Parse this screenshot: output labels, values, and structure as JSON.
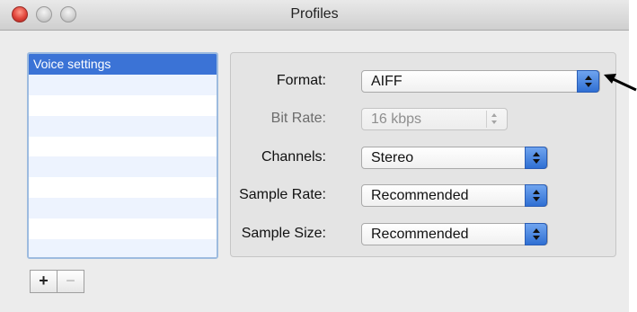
{
  "window": {
    "title": "Profiles"
  },
  "profiles": {
    "items": [
      "Voice settings",
      "",
      "",
      "",
      "",
      "",
      "",
      "",
      "",
      ""
    ],
    "selected_index": 0,
    "add_label": "+",
    "remove_label": "−"
  },
  "settings": {
    "format": {
      "label": "Format:",
      "value": "AIFF"
    },
    "bit_rate": {
      "label": "Bit Rate:",
      "value": "16 kbps",
      "enabled": false
    },
    "channels": {
      "label": "Channels:",
      "value": "Stereo"
    },
    "sample_rate": {
      "label": "Sample Rate:",
      "value": "Recommended"
    },
    "sample_size": {
      "label": "Sample Size:",
      "value": "Recommended"
    }
  },
  "colors": {
    "selection": "#3b73d6",
    "accent": "#2f6fd3"
  },
  "icons": {
    "annotation": "arrow-pointer-icon"
  }
}
